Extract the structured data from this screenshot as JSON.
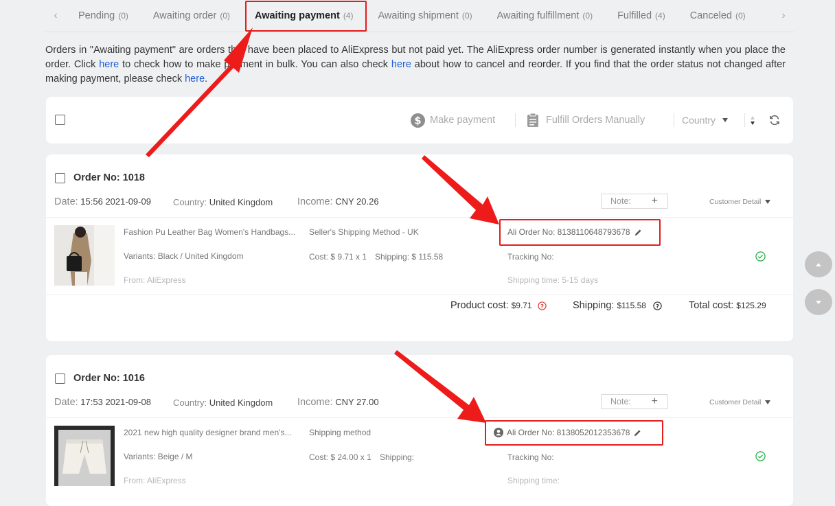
{
  "tabs": [
    {
      "label": "Pending",
      "count": "(0)"
    },
    {
      "label": "Awaiting order",
      "count": "(0)"
    },
    {
      "label": "Awaiting payment",
      "count": "(4)"
    },
    {
      "label": "Awaiting shipment",
      "count": "(0)"
    },
    {
      "label": "Awaiting fulfillment",
      "count": "(0)"
    },
    {
      "label": "Fulfilled",
      "count": "(4)"
    },
    {
      "label": "Canceled",
      "count": "(0)"
    }
  ],
  "tab_prev": "‹",
  "tab_next": "›",
  "intro": {
    "t1": "Orders in \"Awaiting payment\" are orders that have been placed to AliExpress but not paid yet. The AliExpress order number is generated instantly when you place the order. Click ",
    "link1": "here",
    "t2": " to check how to make payment in bulk. You can also check ",
    "link2": "here",
    "t3": " about how to cancel and reorder. If you find that the order status not changed after making payment, please check ",
    "link3": "here",
    "t4": "."
  },
  "toolbar": {
    "make_payment": "Make payment",
    "fulfill_manually": "Fulfill Orders Manually",
    "country": "Country"
  },
  "orders": [
    {
      "title": "Order No: 1018",
      "date_label": "Date:",
      "date": "15:56 2021-09-09",
      "country_label": "Country:",
      "country": "United Kingdom",
      "income_label": "Income:",
      "income": "CNY 20.26",
      "note_label": "Note:",
      "customer_detail": "Customer Detail",
      "product_title": "Fashion Pu Leather Bag Women's Handbags...",
      "variants": "Variants: Black / United Kingdom",
      "from": "From: AliExpress",
      "shipping_method": "Seller's Shipping Method - UK",
      "cost": "Cost: $ 9.71 x 1",
      "shipping": "Shipping: $ 115.58",
      "ali_order": "Ali Order No: 8138110648793678",
      "tracking": "Tracking No:",
      "shipping_time": "Shipping time: 5-15 days",
      "product_cost_label": "Product cost:",
      "product_cost": "$9.71",
      "shipping_label": "Shipping:",
      "shipping_total": "$115.58",
      "total_label": "Total cost:",
      "total": "$125.29"
    },
    {
      "title": "Order No: 1016",
      "date_label": "Date:",
      "date": "17:53 2021-09-08",
      "country_label": "Country:",
      "country": "United Kingdom",
      "income_label": "Income:",
      "income": "CNY 27.00",
      "note_label": "Note:",
      "customer_detail": "Customer Detail",
      "product_title": "2021 new high quality designer brand men's...",
      "variants": "Variants: Beige / M",
      "from": "From: AliExpress",
      "shipping_method": "Shipping method",
      "cost": "Cost: $ 24.00 x 1",
      "shipping": "Shipping:",
      "ali_order": "Ali Order No: 8138052012353678",
      "tracking": "Tracking No:",
      "shipping_time": "Shipping time:"
    }
  ],
  "colors": {
    "accent_red": "#e51c1c",
    "link_blue": "#1f5fd6",
    "success_green": "#2bb24c",
    "help_red": "#e53935"
  }
}
